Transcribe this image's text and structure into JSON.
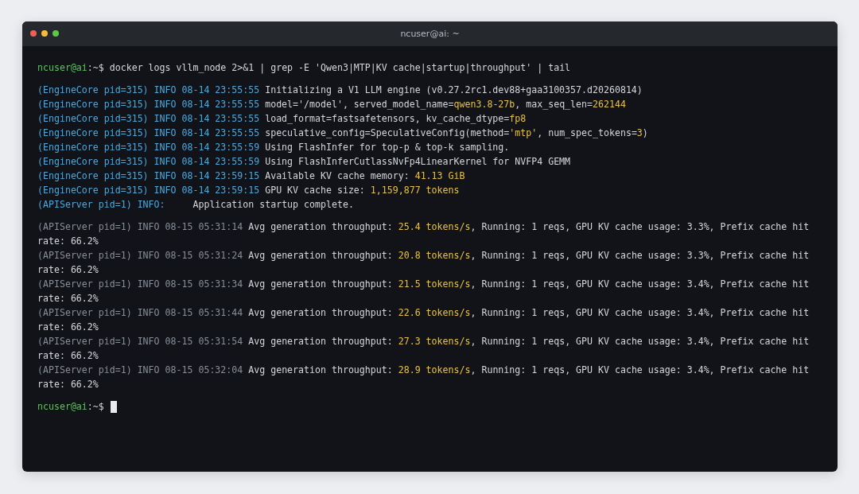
{
  "window": {
    "title": "ncuser@ai: ~"
  },
  "groups": [
    {
      "lines": [
        [
          {
            "text": "ncuser@ai",
            "color": "#5fc25f"
          },
          {
            "text": ":~$ docker logs vllm_node 2>&1 | grep -E 'Qwen3|MTP|KV cache|startup|throughput' | tail"
          }
        ]
      ]
    },
    {
      "lines": [
        [
          {
            "text": "(EngineCore pid=315) INFO 08-14 23:55:55",
            "color": "#4ea8dc"
          },
          {
            "text": " Initializing a V1 LLM engine (v0.27.2rc1.dev88+gaa3100357.d20260814)"
          }
        ],
        [
          {
            "text": "(EngineCore pid=315) INFO 08-14 23:55:55",
            "color": "#4ea8dc"
          },
          {
            "text": " model='/model', served_model_name="
          },
          {
            "text": "qwen3.8-27b",
            "color": "#e6c14a"
          },
          {
            "text": ", max_seq_len="
          },
          {
            "text": "262144",
            "color": "#e6c14a"
          }
        ],
        [
          {
            "text": "(EngineCore pid=315) INFO 08-14 23:55:55",
            "color": "#4ea8dc"
          },
          {
            "text": " load_format=fastsafetensors, kv_cache_dtype="
          },
          {
            "text": "fp8",
            "color": "#e6c14a"
          }
        ],
        [
          {
            "text": "(EngineCore pid=315) INFO 08-14 23:55:55",
            "color": "#4ea8dc"
          },
          {
            "text": " speculative_config=SpeculativeConfig(method="
          },
          {
            "text": "'mtp'",
            "color": "#e6c14a"
          },
          {
            "text": ", num_spec_tokens="
          },
          {
            "text": "3",
            "color": "#e6c14a"
          },
          {
            "text": ")"
          }
        ],
        [
          {
            "text": "(EngineCore pid=315) INFO 08-14 23:55:59",
            "color": "#4ea8dc"
          },
          {
            "text": " Using FlashInfer for top-p & top-k sampling."
          }
        ],
        [
          {
            "text": "(EngineCore pid=315) INFO 08-14 23:55:59",
            "color": "#4ea8dc"
          },
          {
            "text": " Using FlashInferCutlassNvFp4LinearKernel for NVFP4 GEMM"
          }
        ],
        [
          {
            "text": "(EngineCore pid=315) INFO 08-14 23:59:15",
            "color": "#4ea8dc"
          },
          {
            "text": " Available KV cache memory: "
          },
          {
            "text": "41.13 GiB",
            "color": "#e6c14a"
          }
        ],
        [
          {
            "text": "(EngineCore pid=315) INFO 08-14 23:59:15",
            "color": "#4ea8dc"
          },
          {
            "text": " GPU KV cache size: "
          },
          {
            "text": "1,159,877 tokens",
            "color": "#e6c14a"
          }
        ],
        [
          {
            "text": "(APIServer pid=1) INFO:",
            "color": "#4ea8dc"
          },
          {
            "text": "     Application startup complete."
          }
        ]
      ]
    },
    {
      "lines": [
        [
          {
            "text": "(APIServer pid=1) INFO 08-15 05:31:14",
            "color": "#878e98"
          },
          {
            "text": " Avg generation throughput: "
          },
          {
            "text": "25.4 tokens/s",
            "color": "#e6c14a"
          },
          {
            "text": ", Running: 1 reqs, GPU KV cache usage: 3.3%, Prefix cache hit"
          }
        ],
        [
          {
            "text": "rate: 66.2%"
          }
        ],
        [
          {
            "text": "(APIServer pid=1) INFO 08-15 05:31:24",
            "color": "#878e98"
          },
          {
            "text": " Avg generation throughput: "
          },
          {
            "text": "20.8 tokens/s",
            "color": "#e6c14a"
          },
          {
            "text": ", Running: 1 reqs, GPU KV cache usage: 3.3%, Prefix cache hit"
          }
        ],
        [
          {
            "text": "rate: 66.2%"
          }
        ],
        [
          {
            "text": "(APIServer pid=1) INFO 08-15 05:31:34",
            "color": "#878e98"
          },
          {
            "text": " Avg generation throughput: "
          },
          {
            "text": "21.5 tokens/s",
            "color": "#e6c14a"
          },
          {
            "text": ", Running: 1 reqs, GPU KV cache usage: 3.4%, Prefix cache hit"
          }
        ],
        [
          {
            "text": "rate: 66.2%"
          }
        ],
        [
          {
            "text": "(APIServer pid=1) INFO 08-15 05:31:44",
            "color": "#878e98"
          },
          {
            "text": " Avg generation throughput: "
          },
          {
            "text": "22.6 tokens/s",
            "color": "#e6c14a"
          },
          {
            "text": ", Running: 1 reqs, GPU KV cache usage: 3.4%, Prefix cache hit"
          }
        ],
        [
          {
            "text": "rate: 66.2%"
          }
        ],
        [
          {
            "text": "(APIServer pid=1) INFO 08-15 05:31:54",
            "color": "#878e98"
          },
          {
            "text": " Avg generation throughput: "
          },
          {
            "text": "27.3 tokens/s",
            "color": "#e6c14a"
          },
          {
            "text": ", Running: 1 reqs, GPU KV cache usage: 3.4%, Prefix cache hit"
          }
        ],
        [
          {
            "text": "rate: 66.2%"
          }
        ],
        [
          {
            "text": "(APIServer pid=1) INFO 08-15 05:32:04",
            "color": "#878e98"
          },
          {
            "text": " Avg generation throughput: "
          },
          {
            "text": "28.9 tokens/s",
            "color": "#e6c14a"
          },
          {
            "text": ", Running: 1 reqs, GPU KV cache usage: 3.4%, Prefix cache hit"
          }
        ],
        [
          {
            "text": "rate: 66.2%"
          }
        ]
      ]
    }
  ],
  "prompt": {
    "user": "ncuser@ai",
    "path": ":~$",
    "cursor": true
  }
}
